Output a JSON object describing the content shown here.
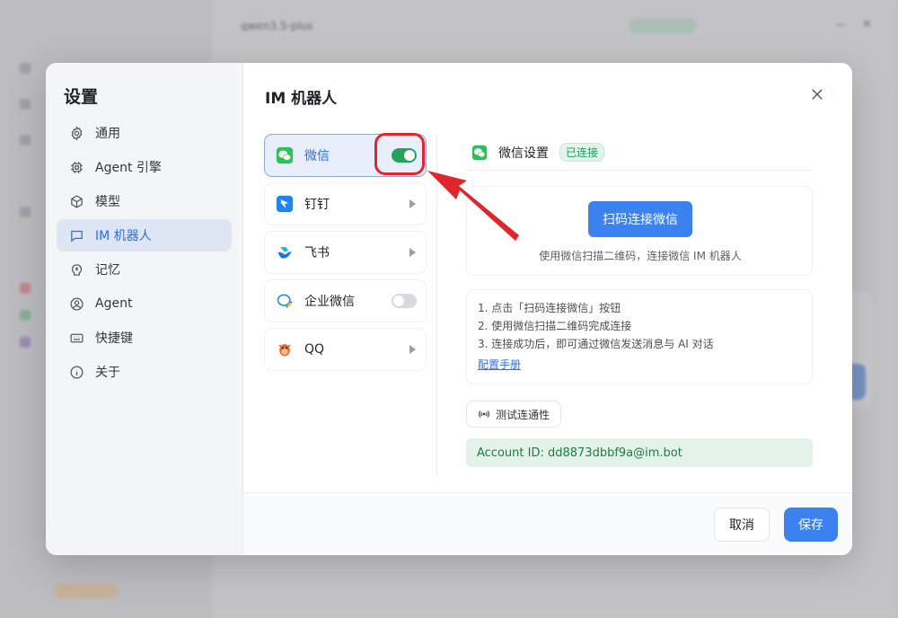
{
  "background": {
    "model_selector": "qwen3.5-plus",
    "window_minimize": "—",
    "window_close": "✕"
  },
  "modal": {
    "title": "设置",
    "nav": [
      {
        "label": "通用",
        "icon": "gear-icon"
      },
      {
        "label": "Agent 引擎",
        "icon": "chip-icon"
      },
      {
        "label": "模型",
        "icon": "cube-icon"
      },
      {
        "label": "IM 机器人",
        "icon": "chat-bubble-icon",
        "active": true
      },
      {
        "label": "记忆",
        "icon": "brain-icon"
      },
      {
        "label": "Agent",
        "icon": "user-circle-icon"
      },
      {
        "label": "快捷键",
        "icon": "keyboard-icon"
      },
      {
        "label": "关于",
        "icon": "info-icon"
      }
    ]
  },
  "content": {
    "title": "IM 机器人",
    "bots": [
      {
        "label": "微信",
        "control": "toggle",
        "enabled": true,
        "selected": true
      },
      {
        "label": "钉钉",
        "control": "chevron"
      },
      {
        "label": "飞书",
        "control": "chevron"
      },
      {
        "label": "企业微信",
        "control": "toggle",
        "enabled": false
      },
      {
        "label": "QQ",
        "control": "chevron"
      }
    ],
    "detail": {
      "title": "微信设置",
      "status": "已连接",
      "qr_button": "扫码连接微信",
      "qr_hint": "使用微信扫描二维码，连接微信 IM 机器人",
      "steps": [
        "1. 点击「扫码连接微信」按钮",
        "2. 使用微信扫描二维码完成连接",
        "3. 连接成功后，即可通过微信发送消息与 AI 对话"
      ],
      "manual_link": "配置手册",
      "test_button": "测试连通性",
      "account": "Account ID: dd8873dbbf9a@im.bot"
    }
  },
  "footer": {
    "cancel": "取消",
    "save": "保存"
  },
  "colors": {
    "accent": "#3b82f0",
    "success": "#25a35c",
    "annotation_red": "#e0262b"
  }
}
